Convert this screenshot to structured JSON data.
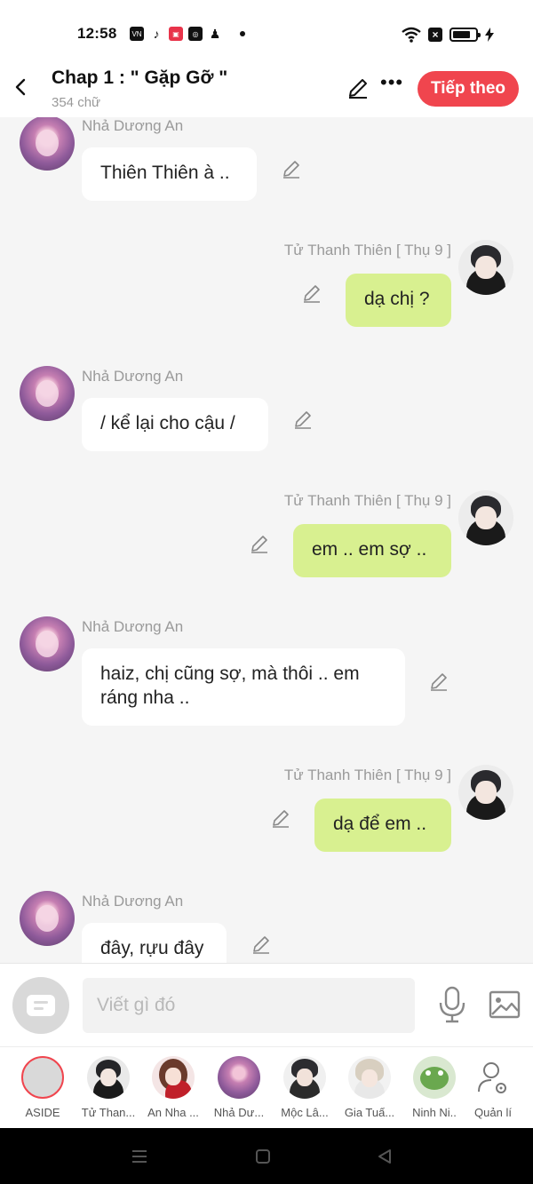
{
  "status_bar": {
    "time": "12:58",
    "app_icons": [
      "vn-app-icon",
      "tiktok-icon",
      "gallery-app-icon",
      "instagram-icon",
      "game-app-icon"
    ],
    "right_icons": [
      "wifi-icon",
      "no-sim-icon",
      "battery-icon",
      "charging-bolt-icon"
    ],
    "battery_level": 0.8
  },
  "header": {
    "title": "Chap 1 : \" Gặp Gỡ \"",
    "subtitle": "354 chữ",
    "next_label": "Tiếp theo",
    "accent_color": "#f0454e"
  },
  "messages": [
    {
      "sender": "Nhả Dương An",
      "side": "left",
      "text": "Thiên Thiên à .."
    },
    {
      "sender": "Tử Thanh Thiên [ Thụ 9 ]",
      "side": "right",
      "text": "dạ chị ?"
    },
    {
      "sender": "Nhả Dương An",
      "side": "left",
      "text": "/ kể lại cho cậu /"
    },
    {
      "sender": "Tử Thanh Thiên [ Thụ 9 ]",
      "side": "right",
      "text": "em .. em sợ .."
    },
    {
      "sender": "Nhả Dương An",
      "side": "left",
      "text": "haiz, chị cũng sợ, mà thôi .. em ráng nha .."
    },
    {
      "sender": "Tử Thanh Thiên [ Thụ 9 ]",
      "side": "right",
      "text": "dạ để em .."
    },
    {
      "sender": "Nhả Dương An",
      "side": "left",
      "text": "đây, rựu đây"
    }
  ],
  "input": {
    "placeholder": "Viết gì đó",
    "value": ""
  },
  "characters": [
    {
      "label": "ASIDE",
      "selected": true
    },
    {
      "label": "Tử Than..."
    },
    {
      "label": "An Nha ..."
    },
    {
      "label": "Nhả Dư..."
    },
    {
      "label": "Mộc Lâ..."
    },
    {
      "label": "Gia Tuấ..."
    },
    {
      "label": "Ninh Ni.."
    },
    {
      "label": "Quản lí"
    }
  ],
  "colors": {
    "left_bubble": "#ffffff",
    "right_bubble": "#d8f090",
    "background": "#f5f5f5"
  }
}
